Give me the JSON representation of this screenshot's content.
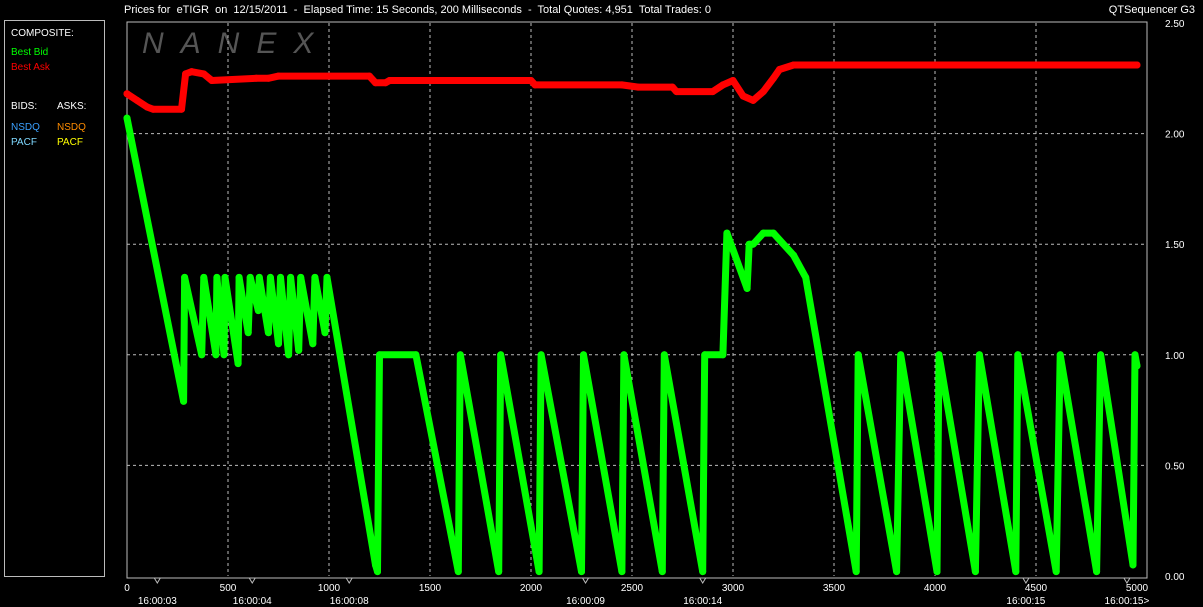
{
  "header": {
    "title": "Prices for  eTIGR  on  12/15/2011  -  Elapsed Time: 15 Seconds, 200 Milliseconds  -  Total Quotes: 4,951  Total Trades: 0",
    "app": "QTSequencer G3"
  },
  "watermark": "NANEX",
  "legend": {
    "composite_heading": "COMPOSITE:",
    "best_bid": "Best Bid",
    "best_ask": "Best Ask",
    "bids_heading": "BIDS:",
    "asks_heading": "ASKS:",
    "bid_nsdq": "NSDQ",
    "bid_pacf": "PACF",
    "ask_nsdq": "NSDQ",
    "ask_pacf": "PACF",
    "colors": {
      "best_bid": "#00ff00",
      "best_ask": "#ff0000",
      "bid_nsdq": "#3aa0ff",
      "bid_pacf": "#7fd8ff",
      "ask_nsdq": "#ff8c00",
      "ask_pacf": "#ffff00",
      "text": "#ffffff"
    }
  },
  "chart_data": {
    "type": "line",
    "xlim": [
      0,
      5000
    ],
    "ylim": [
      0,
      2.5
    ],
    "x_ticks": [
      0,
      500,
      1000,
      1500,
      2000,
      2500,
      3000,
      3500,
      4000,
      4500,
      5000
    ],
    "y_ticks": [
      0,
      0.5,
      1.0,
      1.5,
      2.0,
      2.5
    ],
    "y_tick_labels": [
      "0.00",
      "0.50",
      "1.00",
      "1.50",
      "2.00",
      "2.50"
    ],
    "time_labels": [
      {
        "x": 150,
        "label": "16:00:03"
      },
      {
        "x": 620,
        "label": "16:00:04"
      },
      {
        "x": 1100,
        "label": "16:00:08"
      },
      {
        "x": 2270,
        "label": "16:00:09"
      },
      {
        "x": 2850,
        "label": "16:00:14"
      },
      {
        "x": 4450,
        "label": "16:00:15"
      },
      {
        "x": 4950,
        "label": "16:00:15>"
      }
    ],
    "grid": true,
    "series": [
      {
        "name": "Best Ask",
        "color": "#ff0000",
        "x": [
          0,
          50,
          100,
          130,
          270,
          290,
          320,
          380,
          420,
          640,
          700,
          750,
          1200,
          1230,
          1280,
          1300,
          2000,
          2020,
          2450,
          2530,
          2700,
          2720,
          2900,
          2950,
          3000,
          3050,
          3100,
          3150,
          3200,
          3230,
          3300,
          5000
        ],
        "y": [
          2.18,
          2.15,
          2.12,
          2.11,
          2.11,
          2.27,
          2.28,
          2.27,
          2.24,
          2.25,
          2.25,
          2.26,
          2.26,
          2.23,
          2.23,
          2.24,
          2.24,
          2.22,
          2.22,
          2.21,
          2.21,
          2.19,
          2.19,
          2.22,
          2.24,
          2.17,
          2.15,
          2.19,
          2.25,
          2.29,
          2.31,
          2.31
        ]
      },
      {
        "name": "Best Bid",
        "color": "#00ff00",
        "x": [
          0,
          280,
          285,
          370,
          380,
          440,
          445,
          480,
          485,
          550,
          555,
          600,
          610,
          650,
          655,
          700,
          710,
          750,
          760,
          800,
          810,
          850,
          860,
          920,
          930,
          980,
          990,
          1230,
          1240,
          1250,
          1430,
          1640,
          1650,
          1840,
          1850,
          2040,
          2050,
          2250,
          2260,
          2450,
          2460,
          2650,
          2660,
          2850,
          2860,
          2950,
          2970,
          3070,
          3080,
          3100,
          3150,
          3200,
          3300,
          3360,
          3610,
          3620,
          3810,
          3830,
          4010,
          4020,
          4200,
          4220,
          4400,
          4410,
          4600,
          4620,
          4800,
          4820,
          4980,
          4990,
          5000
        ],
        "y": [
          2.07,
          0.79,
          1.35,
          1.0,
          1.35,
          1.0,
          1.35,
          1.0,
          1.35,
          0.96,
          1.35,
          1.1,
          1.35,
          1.2,
          1.35,
          1.1,
          1.35,
          1.05,
          1.35,
          1.0,
          1.35,
          1.02,
          1.35,
          1.05,
          1.35,
          1.1,
          1.35,
          0.05,
          0.02,
          1.0,
          1.0,
          0.02,
          1.0,
          0.02,
          1.0,
          0.02,
          1.0,
          0.02,
          1.0,
          0.02,
          1.0,
          0.02,
          1.0,
          0.02,
          1.0,
          1.0,
          1.55,
          1.3,
          1.5,
          1.5,
          1.55,
          1.55,
          1.45,
          1.35,
          0.02,
          1.0,
          0.02,
          1.0,
          0.02,
          1.0,
          0.02,
          1.0,
          0.02,
          1.0,
          0.02,
          1.0,
          0.02,
          1.0,
          0.05,
          1.0,
          0.95
        ]
      }
    ]
  }
}
